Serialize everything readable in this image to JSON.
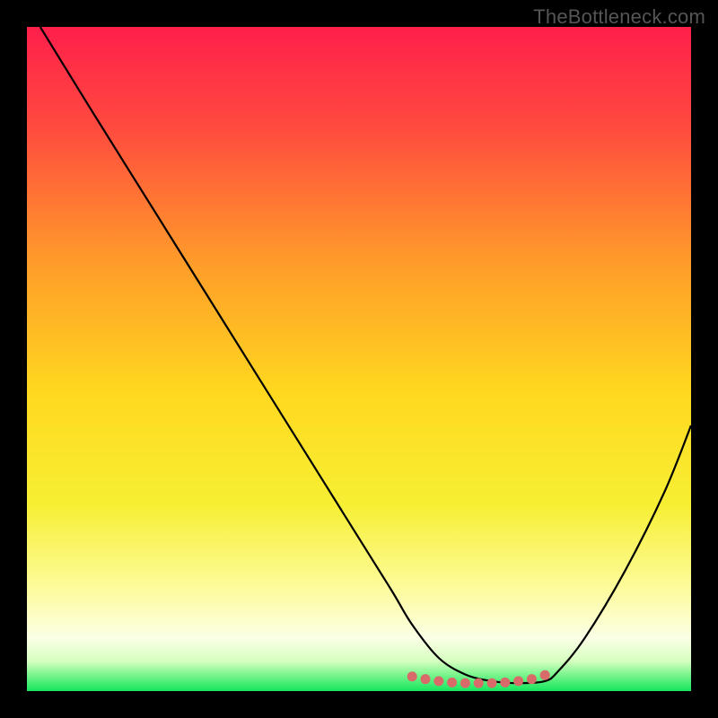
{
  "watermark": "TheBottleneck.com",
  "chart_data": {
    "type": "line",
    "title": "",
    "xlabel": "",
    "ylabel": "",
    "xlim": [
      0,
      100
    ],
    "ylim": [
      0,
      100
    ],
    "grid": false,
    "legend": false,
    "background_gradient": {
      "stops": [
        {
          "offset": 0.0,
          "color": "#ff1f4b"
        },
        {
          "offset": 0.15,
          "color": "#ff4a3f"
        },
        {
          "offset": 0.35,
          "color": "#ff9a2a"
        },
        {
          "offset": 0.55,
          "color": "#ffd81f"
        },
        {
          "offset": 0.72,
          "color": "#f7ef34"
        },
        {
          "offset": 0.85,
          "color": "#fdfca0"
        },
        {
          "offset": 0.92,
          "color": "#fbffe6"
        },
        {
          "offset": 0.955,
          "color": "#d6ffc0"
        },
        {
          "offset": 0.975,
          "color": "#7cf58e"
        },
        {
          "offset": 1.0,
          "color": "#14e65c"
        }
      ]
    },
    "series": [
      {
        "name": "bottleneck-curve",
        "color": "#000000",
        "x": [
          2,
          10,
          20,
          30,
          40,
          50,
          55,
          58,
          62,
          66,
          70,
          74,
          78,
          80,
          84,
          90,
          96,
          100
        ],
        "y": [
          100,
          87,
          71,
          55,
          39,
          23,
          15,
          10,
          5,
          2.5,
          1.5,
          1.2,
          1.5,
          3,
          8,
          18,
          30,
          40
        ]
      }
    ],
    "markers": {
      "name": "optimal-range",
      "color": "#d96a6a",
      "x": [
        58,
        60,
        62,
        64,
        66,
        68,
        70,
        72,
        74,
        76,
        78
      ],
      "y": [
        2.2,
        1.8,
        1.5,
        1.3,
        1.2,
        1.2,
        1.2,
        1.3,
        1.5,
        1.8,
        2.4
      ]
    }
  }
}
